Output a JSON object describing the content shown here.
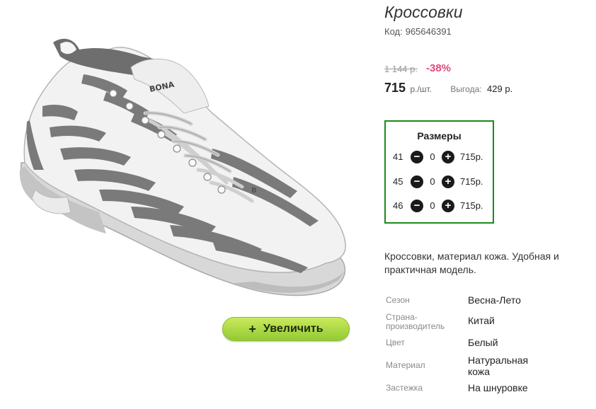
{
  "product": {
    "title": "Кроссовки",
    "code_label": "Код:",
    "code_value": "965646391",
    "old_price": "1 144 р.",
    "discount": "-38%",
    "price": "715",
    "price_unit": "р./шт.",
    "benefit_label": "Выгода:",
    "benefit_value": "429 р."
  },
  "image": {
    "zoom_plus": "+",
    "zoom_label": "Увеличить",
    "logo_text": "BONA",
    "heel_letter": "B"
  },
  "sizes": {
    "title": "Размеры",
    "minus": "−",
    "plus": "+",
    "rows": [
      {
        "size": "41",
        "qty": "0",
        "price": "715р."
      },
      {
        "size": "45",
        "qty": "0",
        "price": "715р."
      },
      {
        "size": "46",
        "qty": "0",
        "price": "715р."
      }
    ]
  },
  "description": "Кроссовки, материал кожа. Удобная и практичная модель.",
  "properties": [
    {
      "key": "Сезон",
      "value": "Весна-Лето"
    },
    {
      "key": "Страна-производитель",
      "value": "Китай"
    },
    {
      "key": "Цвет",
      "value": "Белый"
    },
    {
      "key": "Материал",
      "value": "Натуральная кожа"
    },
    {
      "key": "Застежка",
      "value": "На шнуровке"
    }
  ],
  "colors": {
    "accent_green_border": "#1a8a1a",
    "discount": "#e0477d",
    "zoom_button": "#93c935"
  }
}
